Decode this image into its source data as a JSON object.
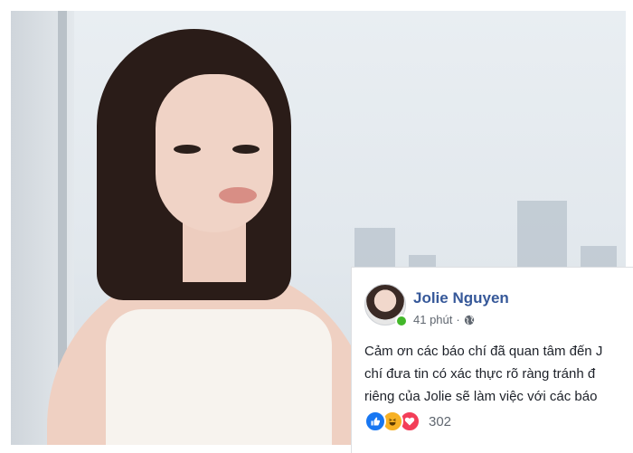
{
  "post": {
    "author": "Jolie Nguyen",
    "time": "41 phút",
    "separator": "·",
    "text_lines": [
      "Cảm ơn các báo chí đã quan tâm đến J",
      "chí đưa tin có xác thực rõ ràng tránh đ",
      "riêng của Jolie sẽ làm việc với các báo"
    ],
    "reaction_count": "302",
    "reactions": [
      "like-icon",
      "haha-icon",
      "love-icon"
    ],
    "privacy_icon": "globe-icon",
    "colors": {
      "name": "#365899",
      "online": "#42b72a",
      "like": "#1877f2",
      "haha": "#f7b125",
      "love": "#f33e58"
    }
  }
}
